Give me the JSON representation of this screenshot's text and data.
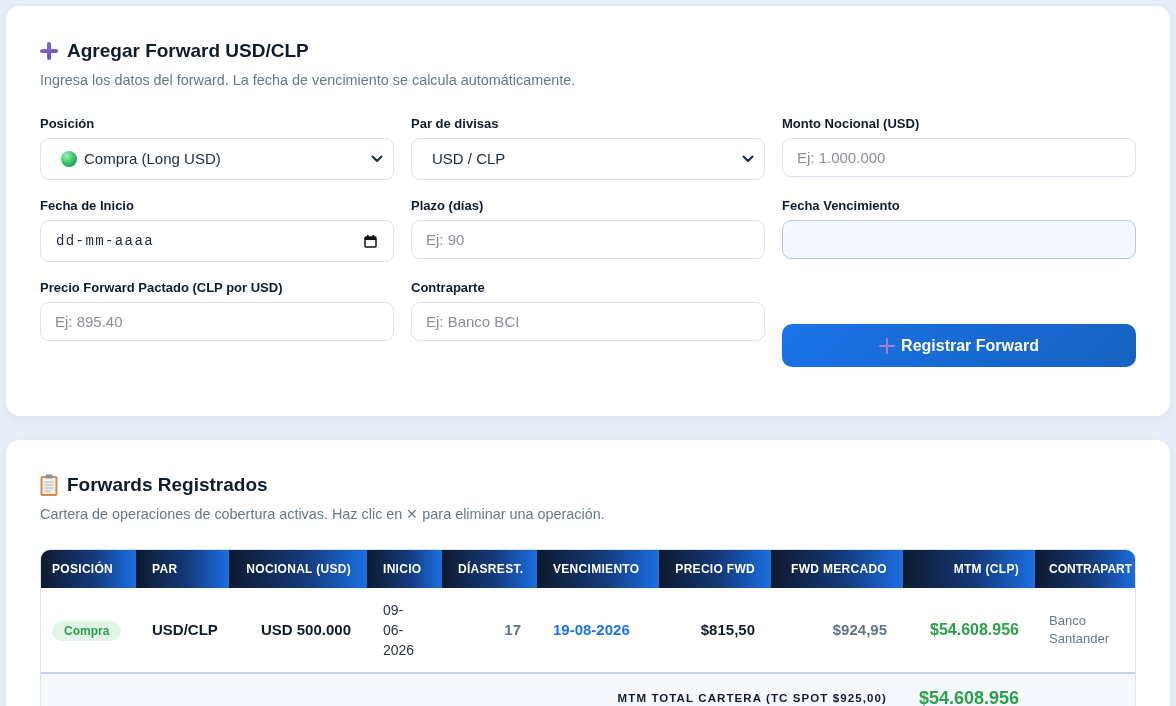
{
  "add_form": {
    "title": "Agregar Forward USD/CLP",
    "subtitle": "Ingresa los datos del forward. La fecha de vencimiento se calcula automáticamente.",
    "fields": [
      {
        "kind": "position",
        "label": "Posición",
        "value": "Compra (Long USD)"
      },
      {
        "kind": "select",
        "label": "Par de divisas",
        "value": "USD / CLP"
      },
      {
        "kind": "text",
        "label": "Monto Nocional (USD)",
        "placeholder": "Ej: 1.000.000"
      },
      {
        "kind": "date",
        "label": "Fecha de Inicio",
        "placeholder": "dd-mm-aaaa"
      },
      {
        "kind": "text",
        "label": "Plazo (días)",
        "placeholder": "Ej: 90"
      },
      {
        "kind": "readonly",
        "label": "Fecha Vencimiento"
      },
      {
        "kind": "text",
        "label": "Precio Forward Pactado (CLP por USD)",
        "placeholder": "Ej: 895.40"
      },
      {
        "kind": "text",
        "label": "Contraparte",
        "placeholder": "Ej: Banco BCI"
      }
    ],
    "submit_button": "Registrar Forward"
  },
  "forwards": {
    "title": "Forwards Registrados",
    "subtitle": "Cartera de operaciones de cobertura activas. Haz clic en ✕ para eliminar una operación.",
    "table": {
      "columns": [
        "POSICIÓN",
        "PAR",
        "NOCIONAL (USD)",
        "INICIO",
        "DÍASREST.",
        "VENCIMIENTO",
        "PRECIO FWD",
        "FWD MERCADO",
        "MTM (CLP)",
        "CONTRAPART"
      ],
      "rows": [
        {
          "position": "Compra",
          "pair": "USD/CLP",
          "notional": "USD 500.000",
          "start": "09-06-2026",
          "days_left": "17",
          "maturity": "19-08-2026",
          "fwd_price": "$815,50",
          "market_fwd": "$924,95",
          "mtm": "$54.608.956",
          "counterparty": "Banco Santander"
        }
      ],
      "footer": {
        "label": "MTM TOTAL CARTERA (TC SPOT $925,00)",
        "value": "$54.608.956"
      }
    }
  }
}
